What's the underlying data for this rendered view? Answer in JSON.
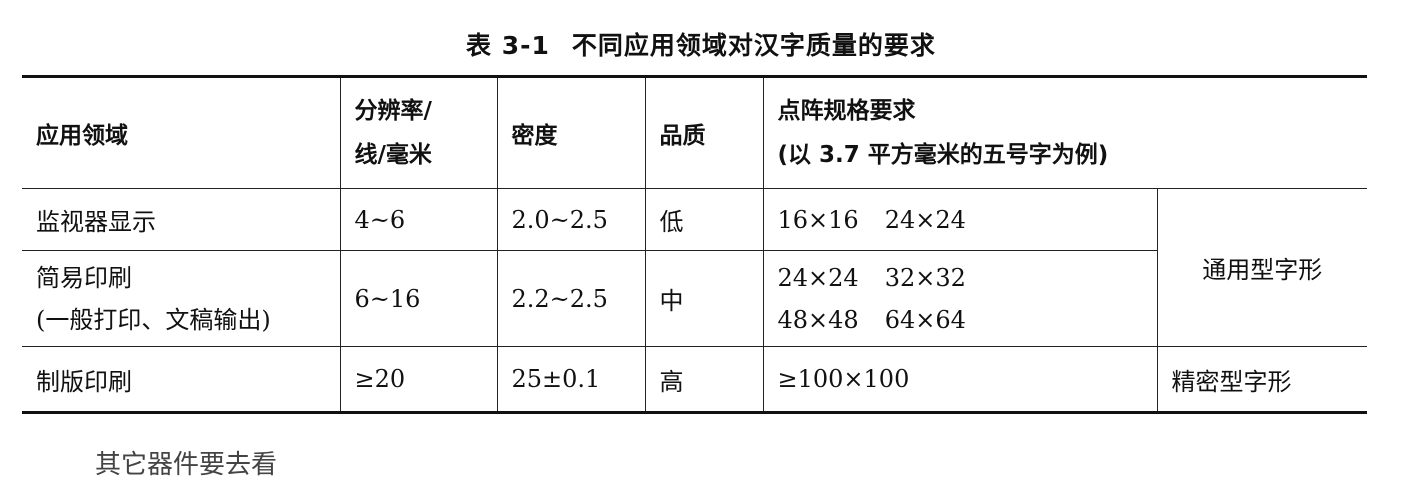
{
  "caption": {
    "number": "表 3-1",
    "title": "不同应用领域对汉字质量的要求"
  },
  "table": {
    "headers": {
      "field": "应用领域",
      "resolution_line1": "分辨率/",
      "resolution_line2": "线/毫米",
      "density": "密度",
      "quality": "品质",
      "dot_matrix_line1": "点阵规格要求",
      "dot_matrix_line2": "(以 3.7 平方毫米的五号字为例)"
    },
    "rows": [
      {
        "field": "监视器显示",
        "resolution": "4~6",
        "density": "2.0~2.5",
        "quality": "低",
        "matrix": [
          "16×16",
          "24×24"
        ]
      },
      {
        "field_line1": "简易印刷",
        "field_line2": "(一般打印、文稿输出)",
        "resolution": "6~16",
        "density": "2.2~2.5",
        "quality": "中",
        "matrix_line1": [
          "24×24",
          "32×32"
        ],
        "matrix_line2": [
          "48×48",
          "64×64"
        ]
      },
      {
        "field": "制版印刷",
        "resolution": "≥20",
        "density": "25±0.1",
        "quality": "高",
        "matrix": "≥100×100",
        "font_type": "精密型字形"
      }
    ],
    "general_font_type": "通用型字形"
  },
  "cut_off_text": "其它器件要去看"
}
